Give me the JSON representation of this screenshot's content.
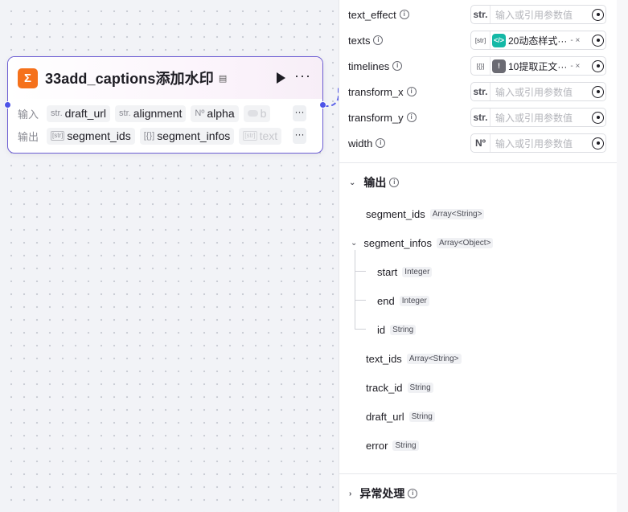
{
  "node": {
    "title": "33add_captions添加水印",
    "logo_glyph": "Σ",
    "logo_color": "#f5711b",
    "border_color": "#6c5dd3",
    "input_label": "输入",
    "output_label": "输出",
    "inputs": [
      {
        "type": "str.",
        "name": "draft_url"
      },
      {
        "type": "str.",
        "name": "alignment"
      },
      {
        "type": "Nº",
        "name": "alpha"
      },
      {
        "type": "toggle",
        "name": "b"
      }
    ],
    "outputs": [
      {
        "type": "[str]",
        "name": "segment_ids"
      },
      {
        "type": "[{}]",
        "name": "segment_infos"
      },
      {
        "type": "[str]",
        "name": "text"
      }
    ],
    "more_label": "···"
  },
  "panel": {
    "params": [
      {
        "name": "text_effect",
        "type": "str.",
        "placeholder": "输入或引用参数值"
      },
      {
        "name": "texts",
        "type": "[str]",
        "chip": {
          "text": "20动态样式···",
          "suffix": "- ×",
          "icon": "</>",
          "color": "#14b8a6"
        }
      },
      {
        "name": "timelines",
        "type": "[{}]",
        "chip": {
          "text": "10提取正文···",
          "suffix": "- ×",
          "icon": "!",
          "color": "#6b6b73"
        }
      },
      {
        "name": "transform_x",
        "type": "str.",
        "placeholder": "输入或引用参数值"
      },
      {
        "name": "transform_y",
        "type": "str.",
        "placeholder": "输入或引用参数值"
      },
      {
        "name": "width",
        "type": "Nº",
        "placeholder": "输入或引用参数值"
      }
    ],
    "output_title": "输出",
    "outputs": [
      {
        "name": "segment_ids",
        "type": "Array<String>"
      },
      {
        "name": "segment_infos",
        "type": "Array<Object>"
      },
      {
        "name": "start",
        "type": "Integer"
      },
      {
        "name": "end",
        "type": "Integer"
      },
      {
        "name": "id",
        "type": "String"
      },
      {
        "name": "text_ids",
        "type": "Array<String>"
      },
      {
        "name": "track_id",
        "type": "String"
      },
      {
        "name": "draft_url",
        "type": "String"
      },
      {
        "name": "error",
        "type": "String"
      }
    ],
    "exception_title": "异常处理"
  }
}
